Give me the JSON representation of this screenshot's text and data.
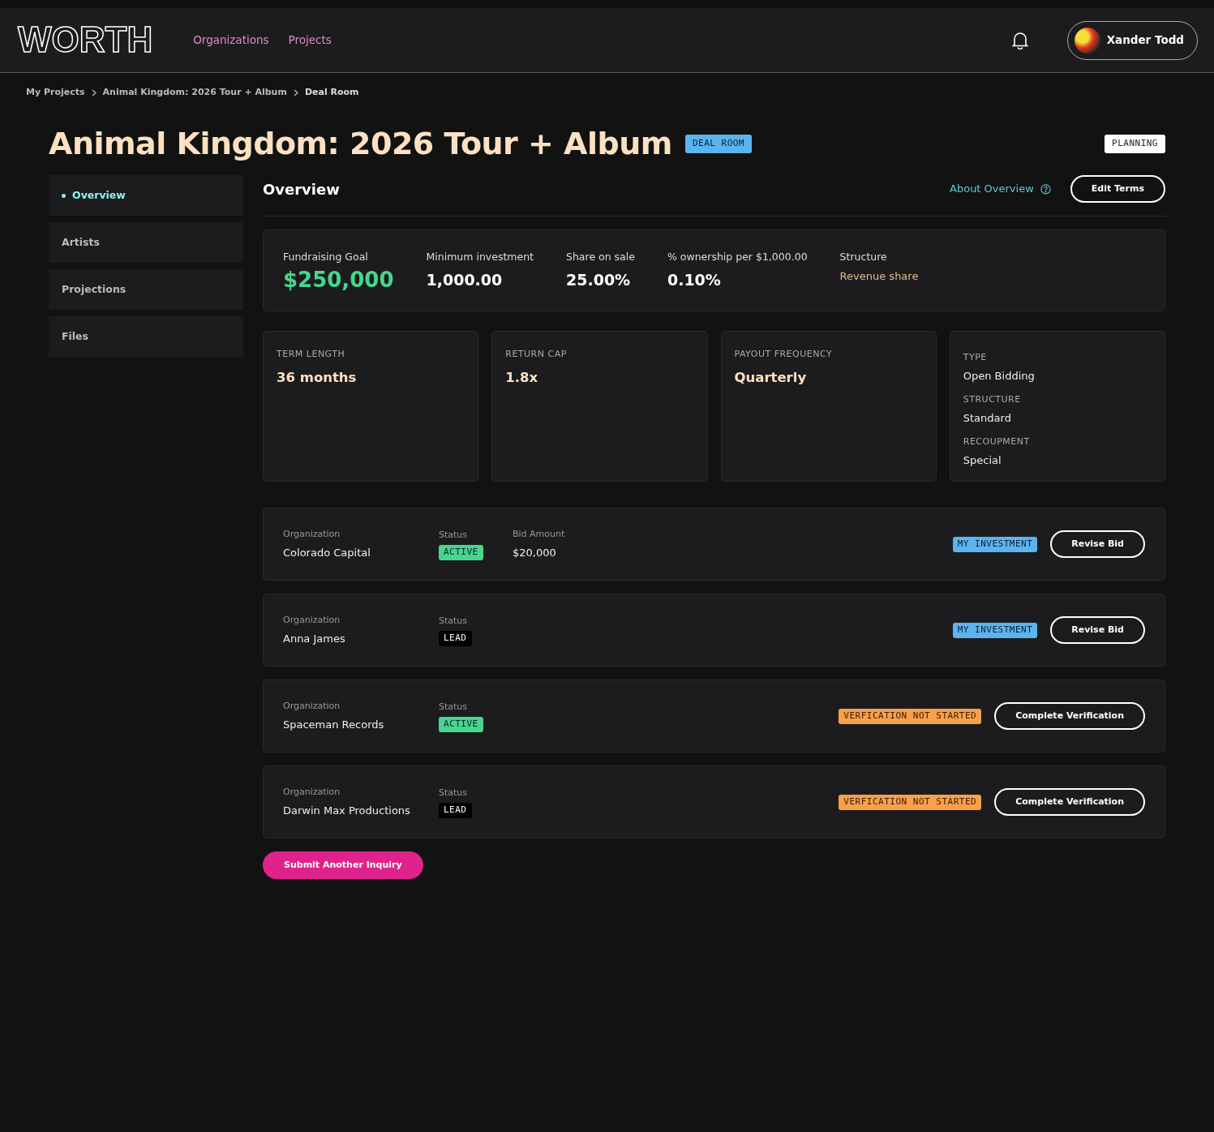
{
  "brand": {
    "logo": "WORTH"
  },
  "nav": [
    {
      "label": "Organizations"
    },
    {
      "label": "Projects"
    }
  ],
  "user": {
    "name": "Xander Todd"
  },
  "breadcrumbs": [
    "My Projects",
    "Animal Kingdom: 2026 Tour + Album",
    "Deal Room"
  ],
  "project": {
    "title": "Animal Kingdom: 2026 Tour + Album",
    "badge": "DEAL ROOM",
    "stage": "PLANNING"
  },
  "sidebar": {
    "items": [
      {
        "label": "Overview",
        "selected": true
      },
      {
        "label": "Artists",
        "selected": false
      },
      {
        "label": "Projections",
        "selected": false
      },
      {
        "label": "Files",
        "selected": false
      }
    ]
  },
  "section": {
    "title": "Overview",
    "help_link": "About Overview",
    "edit_button": "Edit Terms"
  },
  "summary": [
    {
      "label": "Fundraising Goal",
      "value": "$250,000",
      "kind": "goal"
    },
    {
      "label": "Minimum investment",
      "value": "1,000.00",
      "kind": "figure"
    },
    {
      "label": "Share on sale",
      "value": "25.00%",
      "kind": "figure"
    },
    {
      "label": "% ownership per $1,000.00",
      "value": "0.10%",
      "kind": "figure"
    },
    {
      "label": "Structure",
      "value": "Revenue share",
      "kind": "note"
    }
  ],
  "terms": [
    {
      "label": "TERM LENGTH",
      "value": "36 months"
    },
    {
      "label": "RETURN CAP",
      "value": "1.8x"
    },
    {
      "label": "PAYOUT FREQUENCY",
      "value": "Quarterly"
    }
  ],
  "details": [
    {
      "label": "TYPE",
      "value": "Open Bidding"
    },
    {
      "label": "STRUCTURE",
      "value": "Standard"
    },
    {
      "label": "RECOUPMENT",
      "value": "Special"
    }
  ],
  "bids": [
    {
      "organization_label": "Organization",
      "organization": "Colorado Capital",
      "status_label": "Status",
      "status": {
        "label": "ACTIVE",
        "kind": "active"
      },
      "amount_label": "Bid Amount",
      "amount": "$20,000",
      "tag": {
        "label": "MY INVESTMENT",
        "kind": "investment"
      },
      "action": "Revise Bid"
    },
    {
      "organization_label": "Organization",
      "organization": "Anna James",
      "status_label": "Status",
      "status": {
        "label": "LEAD",
        "kind": "lead"
      },
      "tag": {
        "label": "MY INVESTMENT",
        "kind": "investment"
      },
      "action": "Revise Bid"
    },
    {
      "organization_label": "Organization",
      "organization": "Spaceman Records",
      "status_label": "Status",
      "status": {
        "label": "ACTIVE",
        "kind": "active"
      },
      "tag": {
        "label": "VERFICATION NOT STARTED",
        "kind": "verification"
      },
      "action": "Complete Verification"
    },
    {
      "organization_label": "Organization",
      "organization": "Darwin Max Productions",
      "status_label": "Status",
      "status": {
        "label": "LEAD",
        "kind": "lead"
      },
      "tag": {
        "label": "VERFICATION NOT STARTED",
        "kind": "verification"
      },
      "action": "Complete Verification"
    }
  ],
  "submit_button": "Submit Another Inquiry"
}
